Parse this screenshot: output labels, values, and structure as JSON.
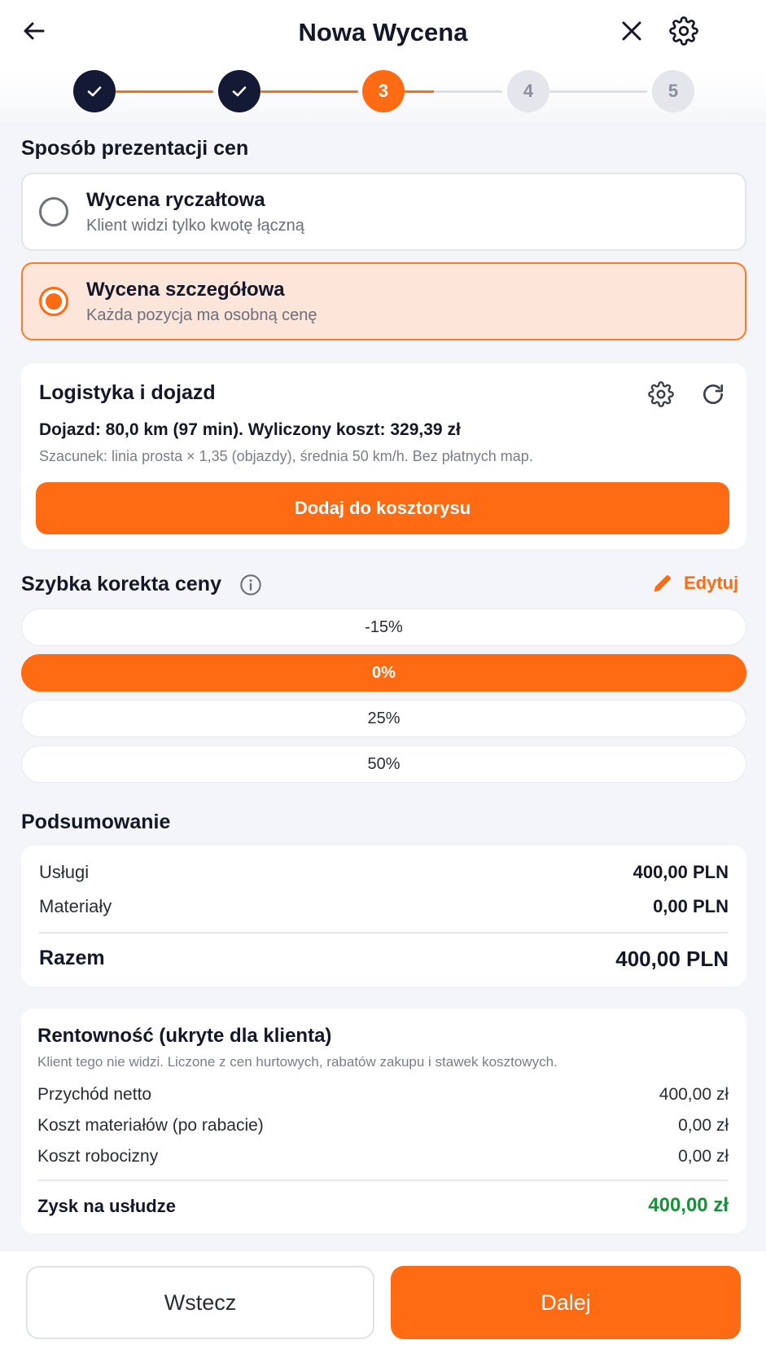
{
  "header": {
    "title": "Nowa Wycena",
    "back_icon": "arrow-left-icon",
    "close_icon": "close-icon",
    "settings_icon": "gear-icon"
  },
  "stepper": {
    "steps": [
      {
        "label": "",
        "state": "done"
      },
      {
        "label": "",
        "state": "done"
      },
      {
        "label": "3",
        "state": "active"
      },
      {
        "label": "4",
        "state": "todo"
      },
      {
        "label": "5",
        "state": "todo"
      }
    ]
  },
  "pricing": {
    "title": "Sposób prezentacji cen",
    "options": [
      {
        "title": "Wycena ryczałtowa",
        "subtitle": "Klient widzi tylko kwotę łączną",
        "selected": false
      },
      {
        "title": "Wycena szczegółowa",
        "subtitle": "Każda pozycja ma osobną cenę",
        "selected": true
      }
    ]
  },
  "logistics": {
    "title": "Logistyka i dojazd",
    "summary": "Dojazd: 80,0 km (97 min). Wyliczony koszt: 329,39 zł",
    "note": "Szacunek: linia prosta × 1,35 (objazdy), średnia 50 km/h. Bez płatnych map.",
    "add_button": "Dodaj do kosztorysu"
  },
  "correction": {
    "title": "Szybka korekta ceny",
    "edit_label": "Edytuj",
    "options": [
      {
        "label": "-15%",
        "active": false
      },
      {
        "label": "0%",
        "active": true
      },
      {
        "label": "25%",
        "active": false
      },
      {
        "label": "50%",
        "active": false
      }
    ]
  },
  "summary": {
    "title": "Podsumowanie",
    "services_label": "Usługi",
    "services_value": "400,00 PLN",
    "materials_label": "Materiały",
    "materials_value": "0,00 PLN",
    "total_label": "Razem",
    "total_value": "400,00 PLN"
  },
  "profitability": {
    "title": "Rentowność (ukryte dla klienta)",
    "note": "Klient tego nie widzi. Liczone z cen hurtowych, rabatów zakupu i stawek kosztowych.",
    "rows": [
      {
        "label": "Przychód netto",
        "value": "400,00 zł"
      },
      {
        "label": "Koszt materiałów (po rabacie)",
        "value": "0,00 zł"
      },
      {
        "label": "Koszt robocizny",
        "value": "0,00 zł"
      }
    ],
    "profit_label": "Zysk na usłudze",
    "profit_value": "400,00 zł"
  },
  "footer": {
    "back_label": "Wstecz",
    "next_label": "Dalej"
  },
  "colors": {
    "accent": "#ff6b12",
    "dark": "#141a35",
    "profit": "#1a8f3a"
  }
}
